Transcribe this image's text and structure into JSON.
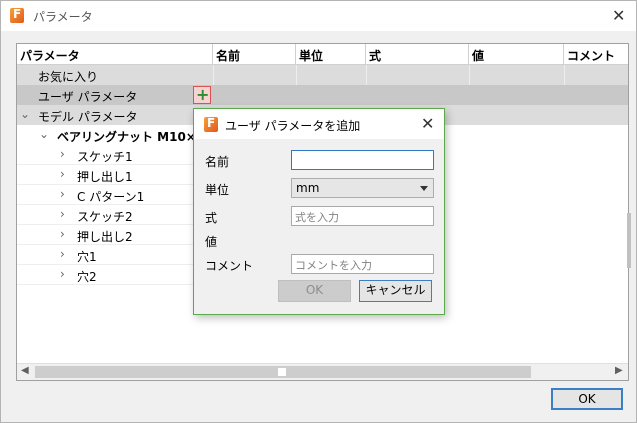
{
  "window": {
    "title": "パラメータ",
    "ok_label": "OK"
  },
  "table": {
    "columns": [
      "パラメータ",
      "名前",
      "単位",
      "式",
      "値",
      "コメント"
    ],
    "rows": {
      "favorites": "お気に入り",
      "user_params": "ユーザ パラメータ",
      "model_params": "モデル パラメータ",
      "component": "ベアリングナット M10×1.5",
      "features": [
        "スケッチ1",
        "押し出し1",
        "C パターン1",
        "スケッチ2",
        "押し出し2",
        "穴1",
        "穴2"
      ]
    }
  },
  "dialog": {
    "title": "ユーザ パラメータを追加",
    "name_label": "名前",
    "name_value": "",
    "unit_label": "単位",
    "unit_value": "mm",
    "expr_label": "式",
    "expr_placeholder": "式を入力",
    "value_label": "値",
    "comment_label": "コメント",
    "comment_placeholder": "コメントを入力",
    "ok_label": "OK",
    "cancel_label": "キャンセル"
  }
}
